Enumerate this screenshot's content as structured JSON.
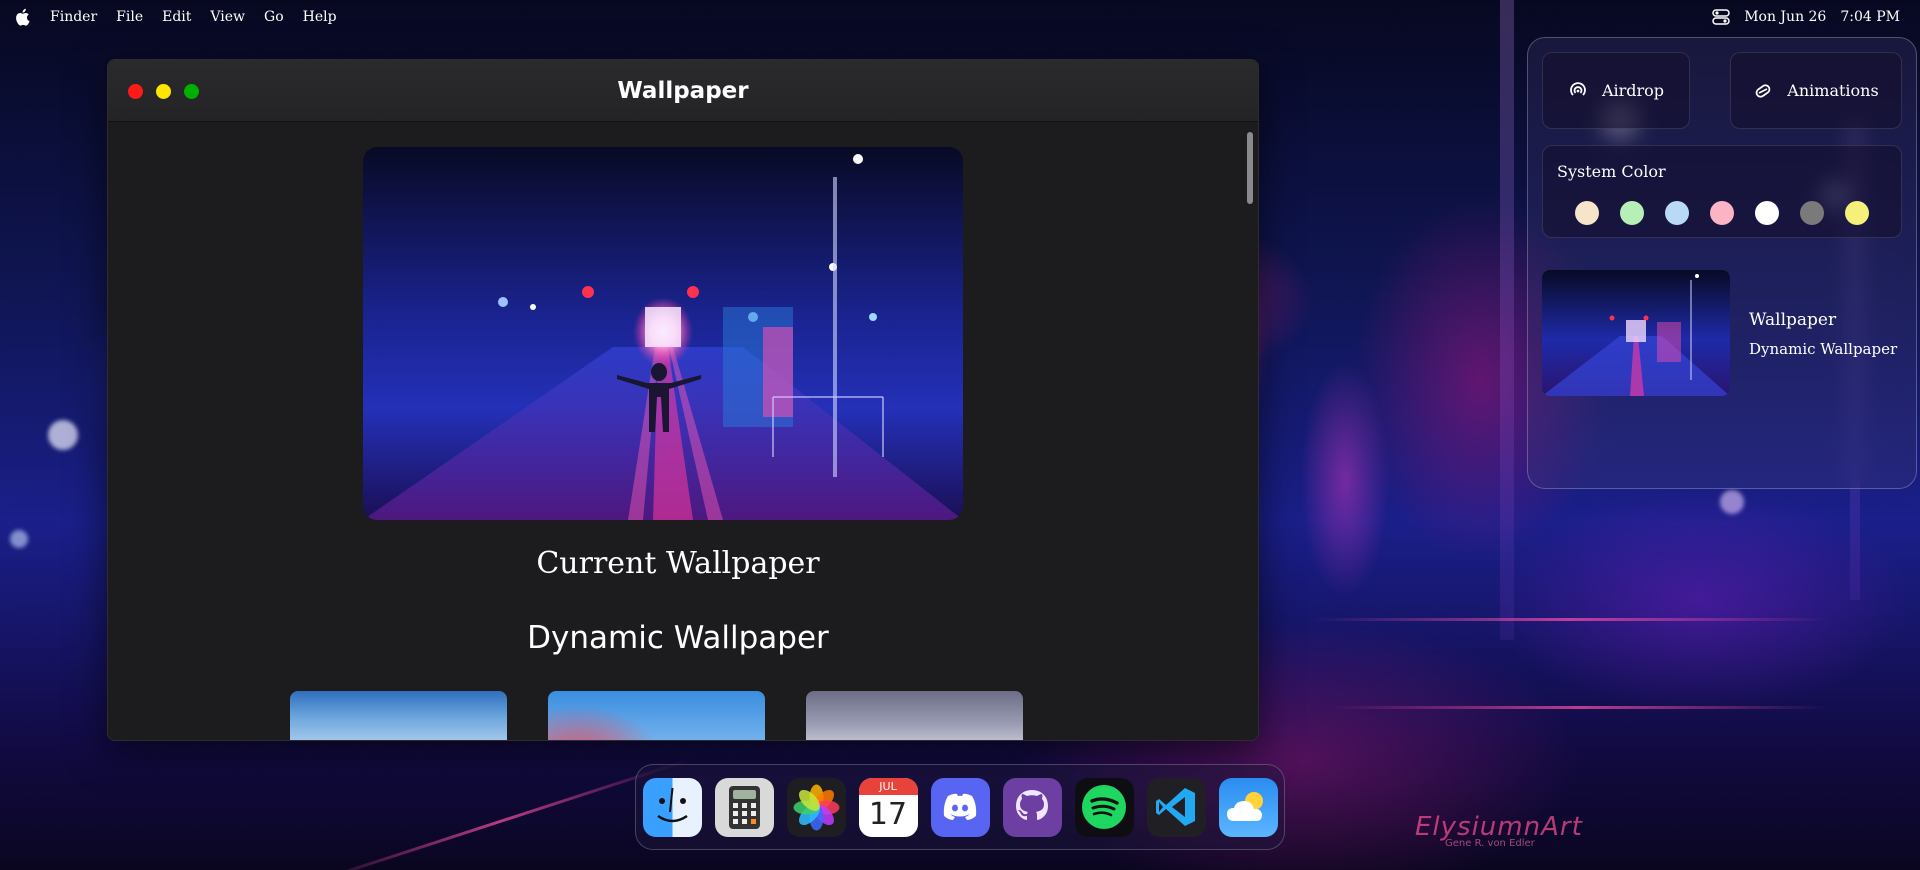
{
  "menubar": {
    "apple_icon": "apple-icon",
    "items": [
      "Finder",
      "File",
      "Edit",
      "View",
      "Go",
      "Help"
    ],
    "control_icon": "control-center-icon",
    "date": "Mon Jun 26",
    "time": "7:04 PM"
  },
  "window": {
    "title": "Wallpaper",
    "current_caption": "Current Wallpaper",
    "dynamic_heading": "Dynamic Wallpaper"
  },
  "control_center": {
    "airdrop_label": "Airdrop",
    "animations_label": "Animations",
    "system_color_title": "System Color",
    "colors": [
      "#f6e5c8",
      "#b6f0b8",
      "#b8daf6",
      "#fbb4c4",
      "#ffffff",
      "#7a7a7a",
      "#f5f07a"
    ],
    "wallpaper_label": "Wallpaper",
    "wallpaper_sub": "Dynamic Wallpaper"
  },
  "dock": {
    "apps": [
      "finder",
      "calculator",
      "photos",
      "calendar",
      "discord",
      "github",
      "spotify",
      "vscode",
      "weather"
    ],
    "calendar_month": "JUL",
    "calendar_day": "17"
  },
  "watermark": {
    "brand": "ElysiumnArt",
    "credit": "Gene R. von Edler"
  }
}
